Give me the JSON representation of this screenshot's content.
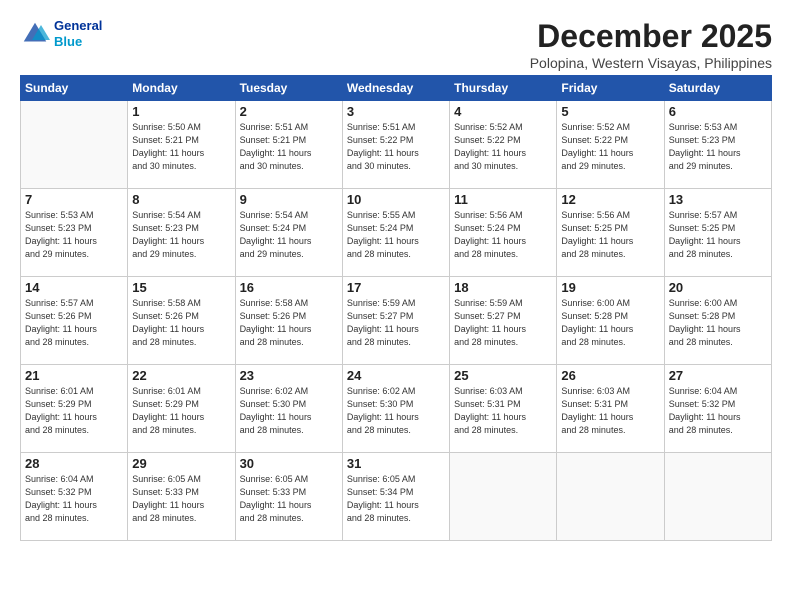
{
  "logo": {
    "line1": "General",
    "line2": "Blue"
  },
  "title": "December 2025",
  "location": "Polopina, Western Visayas, Philippines",
  "weekdays": [
    "Sunday",
    "Monday",
    "Tuesday",
    "Wednesday",
    "Thursday",
    "Friday",
    "Saturday"
  ],
  "weeks": [
    [
      {
        "day": "",
        "info": ""
      },
      {
        "day": "1",
        "info": "Sunrise: 5:50 AM\nSunset: 5:21 PM\nDaylight: 11 hours\nand 30 minutes."
      },
      {
        "day": "2",
        "info": "Sunrise: 5:51 AM\nSunset: 5:21 PM\nDaylight: 11 hours\nand 30 minutes."
      },
      {
        "day": "3",
        "info": "Sunrise: 5:51 AM\nSunset: 5:22 PM\nDaylight: 11 hours\nand 30 minutes."
      },
      {
        "day": "4",
        "info": "Sunrise: 5:52 AM\nSunset: 5:22 PM\nDaylight: 11 hours\nand 30 minutes."
      },
      {
        "day": "5",
        "info": "Sunrise: 5:52 AM\nSunset: 5:22 PM\nDaylight: 11 hours\nand 29 minutes."
      },
      {
        "day": "6",
        "info": "Sunrise: 5:53 AM\nSunset: 5:23 PM\nDaylight: 11 hours\nand 29 minutes."
      }
    ],
    [
      {
        "day": "7",
        "info": "Sunrise: 5:53 AM\nSunset: 5:23 PM\nDaylight: 11 hours\nand 29 minutes."
      },
      {
        "day": "8",
        "info": "Sunrise: 5:54 AM\nSunset: 5:23 PM\nDaylight: 11 hours\nand 29 minutes."
      },
      {
        "day": "9",
        "info": "Sunrise: 5:54 AM\nSunset: 5:24 PM\nDaylight: 11 hours\nand 29 minutes."
      },
      {
        "day": "10",
        "info": "Sunrise: 5:55 AM\nSunset: 5:24 PM\nDaylight: 11 hours\nand 28 minutes."
      },
      {
        "day": "11",
        "info": "Sunrise: 5:56 AM\nSunset: 5:24 PM\nDaylight: 11 hours\nand 28 minutes."
      },
      {
        "day": "12",
        "info": "Sunrise: 5:56 AM\nSunset: 5:25 PM\nDaylight: 11 hours\nand 28 minutes."
      },
      {
        "day": "13",
        "info": "Sunrise: 5:57 AM\nSunset: 5:25 PM\nDaylight: 11 hours\nand 28 minutes."
      }
    ],
    [
      {
        "day": "14",
        "info": "Sunrise: 5:57 AM\nSunset: 5:26 PM\nDaylight: 11 hours\nand 28 minutes."
      },
      {
        "day": "15",
        "info": "Sunrise: 5:58 AM\nSunset: 5:26 PM\nDaylight: 11 hours\nand 28 minutes."
      },
      {
        "day": "16",
        "info": "Sunrise: 5:58 AM\nSunset: 5:26 PM\nDaylight: 11 hours\nand 28 minutes."
      },
      {
        "day": "17",
        "info": "Sunrise: 5:59 AM\nSunset: 5:27 PM\nDaylight: 11 hours\nand 28 minutes."
      },
      {
        "day": "18",
        "info": "Sunrise: 5:59 AM\nSunset: 5:27 PM\nDaylight: 11 hours\nand 28 minutes."
      },
      {
        "day": "19",
        "info": "Sunrise: 6:00 AM\nSunset: 5:28 PM\nDaylight: 11 hours\nand 28 minutes."
      },
      {
        "day": "20",
        "info": "Sunrise: 6:00 AM\nSunset: 5:28 PM\nDaylight: 11 hours\nand 28 minutes."
      }
    ],
    [
      {
        "day": "21",
        "info": "Sunrise: 6:01 AM\nSunset: 5:29 PM\nDaylight: 11 hours\nand 28 minutes."
      },
      {
        "day": "22",
        "info": "Sunrise: 6:01 AM\nSunset: 5:29 PM\nDaylight: 11 hours\nand 28 minutes."
      },
      {
        "day": "23",
        "info": "Sunrise: 6:02 AM\nSunset: 5:30 PM\nDaylight: 11 hours\nand 28 minutes."
      },
      {
        "day": "24",
        "info": "Sunrise: 6:02 AM\nSunset: 5:30 PM\nDaylight: 11 hours\nand 28 minutes."
      },
      {
        "day": "25",
        "info": "Sunrise: 6:03 AM\nSunset: 5:31 PM\nDaylight: 11 hours\nand 28 minutes."
      },
      {
        "day": "26",
        "info": "Sunrise: 6:03 AM\nSunset: 5:31 PM\nDaylight: 11 hours\nand 28 minutes."
      },
      {
        "day": "27",
        "info": "Sunrise: 6:04 AM\nSunset: 5:32 PM\nDaylight: 11 hours\nand 28 minutes."
      }
    ],
    [
      {
        "day": "28",
        "info": "Sunrise: 6:04 AM\nSunset: 5:32 PM\nDaylight: 11 hours\nand 28 minutes."
      },
      {
        "day": "29",
        "info": "Sunrise: 6:05 AM\nSunset: 5:33 PM\nDaylight: 11 hours\nand 28 minutes."
      },
      {
        "day": "30",
        "info": "Sunrise: 6:05 AM\nSunset: 5:33 PM\nDaylight: 11 hours\nand 28 minutes."
      },
      {
        "day": "31",
        "info": "Sunrise: 6:05 AM\nSunset: 5:34 PM\nDaylight: 11 hours\nand 28 minutes."
      },
      {
        "day": "",
        "info": ""
      },
      {
        "day": "",
        "info": ""
      },
      {
        "day": "",
        "info": ""
      }
    ]
  ]
}
